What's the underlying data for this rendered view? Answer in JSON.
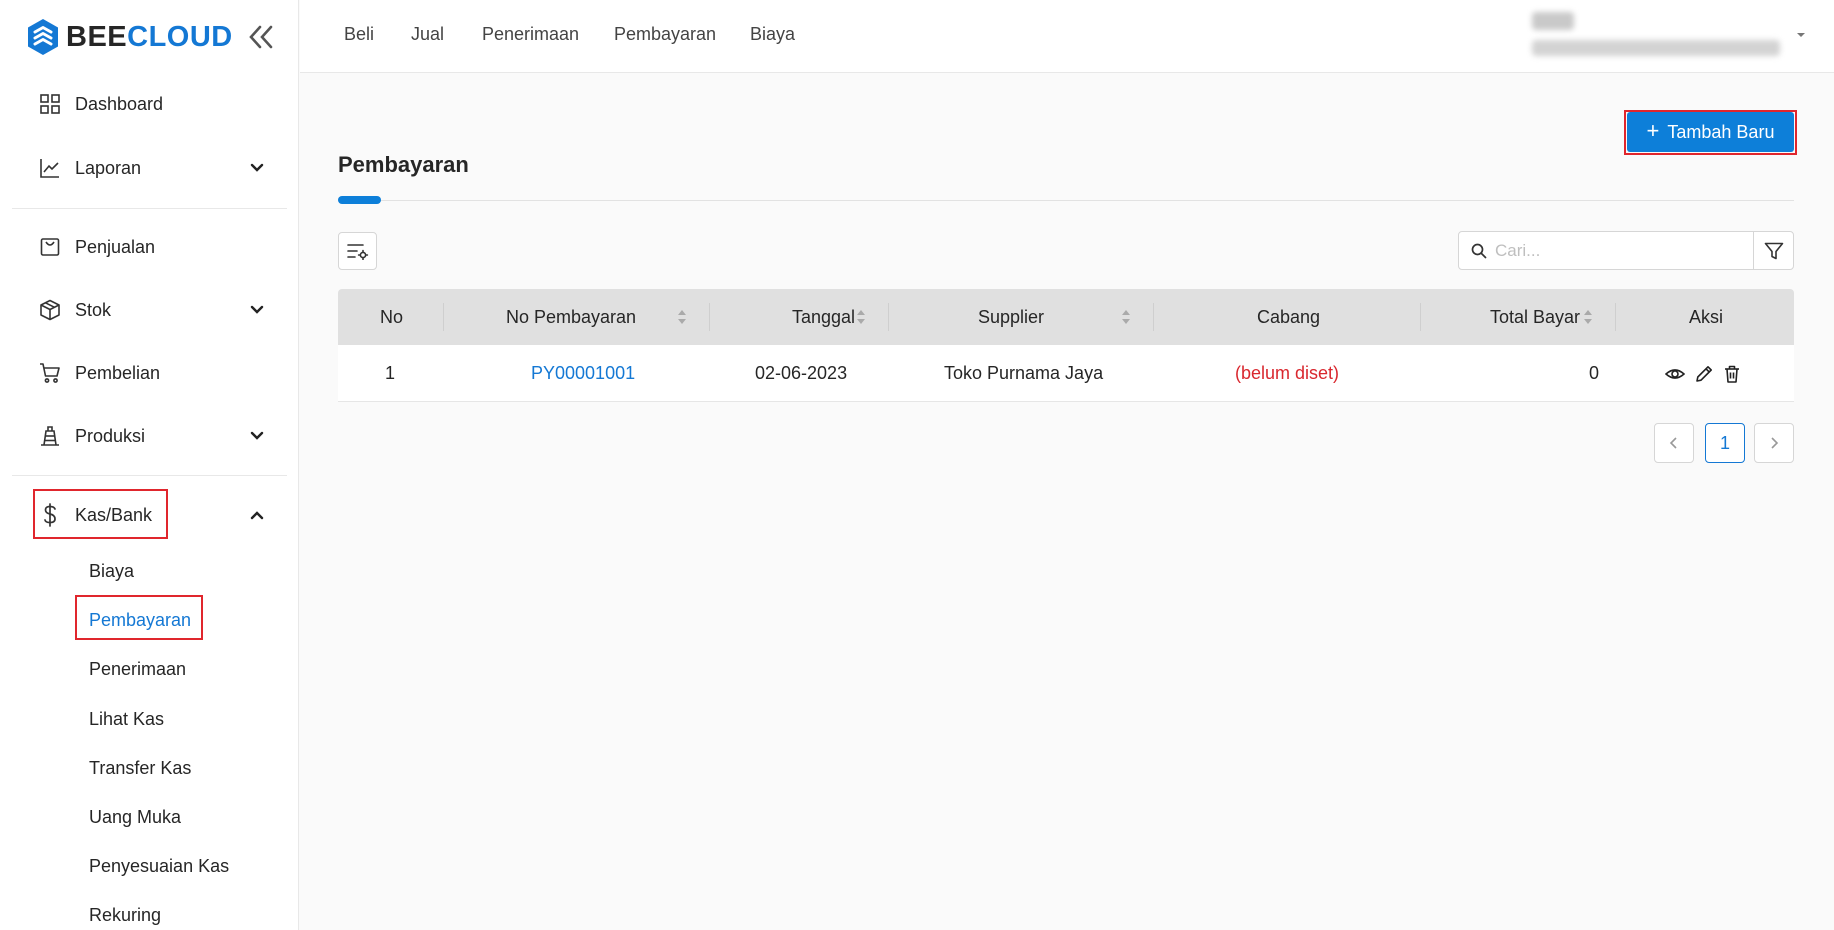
{
  "brand": {
    "part1": "BEE",
    "part2": "CLOUD"
  },
  "sidebar": {
    "items": [
      {
        "label": "Dashboard",
        "icon": "dashboard-icon"
      },
      {
        "label": "Laporan",
        "icon": "chart-line-icon",
        "has_children": true
      },
      {
        "label": "Penjualan",
        "icon": "shopping-bag-icon"
      },
      {
        "label": "Stok",
        "icon": "box-icon",
        "has_children": true
      },
      {
        "label": "Pembelian",
        "icon": "cart-icon"
      },
      {
        "label": "Produksi",
        "icon": "factory-icon",
        "has_children": true
      },
      {
        "label": "Kas/Bank",
        "icon": "dollar-icon",
        "has_children": true,
        "expanded": true
      }
    ],
    "kas_bank_sub": [
      "Biaya",
      "Pembayaran",
      "Penerimaan",
      "Lihat Kas",
      "Transfer Kas",
      "Uang Muka",
      "Penyesuaian Kas",
      "Rekuring"
    ],
    "active_sub": "Pembayaran"
  },
  "topnav": [
    "Beli",
    "Jual",
    "Penerimaan",
    "Pembayaran",
    "Biaya"
  ],
  "main": {
    "add_button": "Tambah Baru",
    "title": "Pembayaran",
    "search_placeholder": "Cari..."
  },
  "table": {
    "columns": [
      "No",
      "No Pembayaran",
      "Tanggal",
      "Supplier",
      "Cabang",
      "Total Bayar",
      "Aksi"
    ],
    "rows": [
      {
        "no": "1",
        "no_pembayaran": "PY00001001",
        "tanggal": "02-06-2023",
        "supplier": "Toko Purnama Jaya",
        "cabang": "(belum diset)",
        "total_bayar": "0"
      }
    ]
  },
  "pagination": {
    "prev": "<",
    "current": "1",
    "next": ">"
  },
  "colors": {
    "accent": "#0d7fd9",
    "link": "#1478d4",
    "warning": "#d9272e",
    "highlight": "#e0262d"
  }
}
